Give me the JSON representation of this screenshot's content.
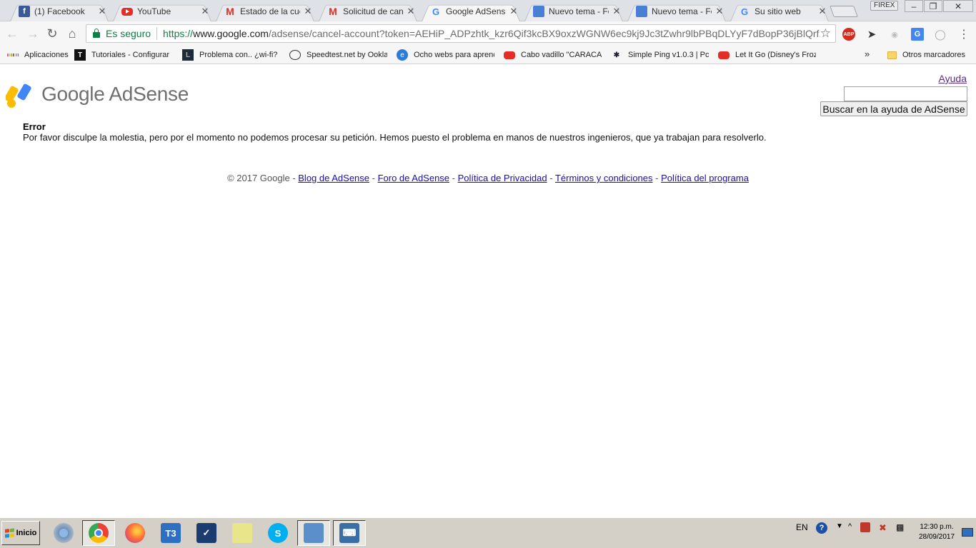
{
  "browser": {
    "tabs": [
      {
        "label": "(1) Facebook",
        "icon": "facebook-icon"
      },
      {
        "label": "YouTube",
        "icon": "youtube-icon"
      },
      {
        "label": "Estado de la cuen",
        "icon": "gmail-icon"
      },
      {
        "label": "Solicitud de canc",
        "icon": "gmail-icon"
      },
      {
        "label": "Google AdSense",
        "icon": "google-icon",
        "active": true
      },
      {
        "label": "Nuevo tema - Fo",
        "icon": "forum-icon"
      },
      {
        "label": "Nuevo tema - Fo",
        "icon": "forum-icon"
      },
      {
        "label": "Su sitio web",
        "icon": "google-icon"
      }
    ],
    "profile_label": "FIREX",
    "window_controls": {
      "minimize": "–",
      "restore": "❐",
      "close": "✕"
    },
    "tab_close_glyph": "✕",
    "omnibox": {
      "secure_label": "Es seguro",
      "url_scheme": "https://",
      "url_host": "www.google.com",
      "url_rest": "/adsense/cancel-account?token=AEHiP_ADPzhtk_kzr6Qif3kcBX9oxzWGNW6ec9kj9Jc3tZwhr9lbPBqDLYyF7dBopP36jBlQrf..."
    },
    "extensions": [
      "ABP",
      "G"
    ],
    "bookmarks": [
      {
        "label": "Aplicaciones",
        "icon": "apps-icon"
      },
      {
        "label": "Tutoriales - Configurar",
        "icon": "t-icon"
      },
      {
        "label": "Problema con.. ¿wi-fi?",
        "icon": "lol-icon"
      },
      {
        "label": "Speedtest.net by Ookla",
        "icon": "speedtest-icon"
      },
      {
        "label": "Ocho webs para aprenc",
        "icon": "web-icon"
      },
      {
        "label": "Cabo vadillo \"CARACAS",
        "icon": "youtube-icon"
      },
      {
        "label": "Simple Ping v1.0.3 | Pc",
        "icon": "ping-icon"
      },
      {
        "label": "Let It Go (Disney's Froz",
        "icon": "youtube-icon"
      }
    ],
    "other_bookmarks": "Otros marcadores",
    "overflow_glyph": "»"
  },
  "page": {
    "logo_text": "Google AdSense",
    "help_link": "Ayuda",
    "help_search_value": "",
    "help_search_button": "Buscar en la ayuda de AdSense",
    "error_title": "Error",
    "error_message": "Por favor disculpe la molestia, pero por el momento no podemos procesar su petición. Hemos puesto el problema en manos de nuestros ingenieros, que ya trabajan para resolverlo.",
    "footer": {
      "copyright": "© 2017 Google - ",
      "links": [
        "Blog de AdSense",
        "Foro de AdSense",
        "Política de Privacidad",
        "Términos y condiciones",
        "Política del programa"
      ],
      "separator": " - "
    }
  },
  "taskbar": {
    "start_label": "Inicio",
    "apps": [
      "chrome-old-icon",
      "chrome-icon",
      "firefox-icon",
      "t3-icon",
      "tool-icon",
      "sticky-notes-icon",
      "skype-icon",
      "control-panel-icon",
      "keyboard-icon"
    ],
    "language": "EN",
    "time": "12:30 p.m.",
    "date": "28/09/2017"
  },
  "colors": {
    "secure_green": "#0b8043",
    "link_blue": "#1a0dab",
    "visited_purple": "#5b2a8c",
    "adsense_yellow": "#fbbc04",
    "adsense_blue": "#4285f4"
  }
}
